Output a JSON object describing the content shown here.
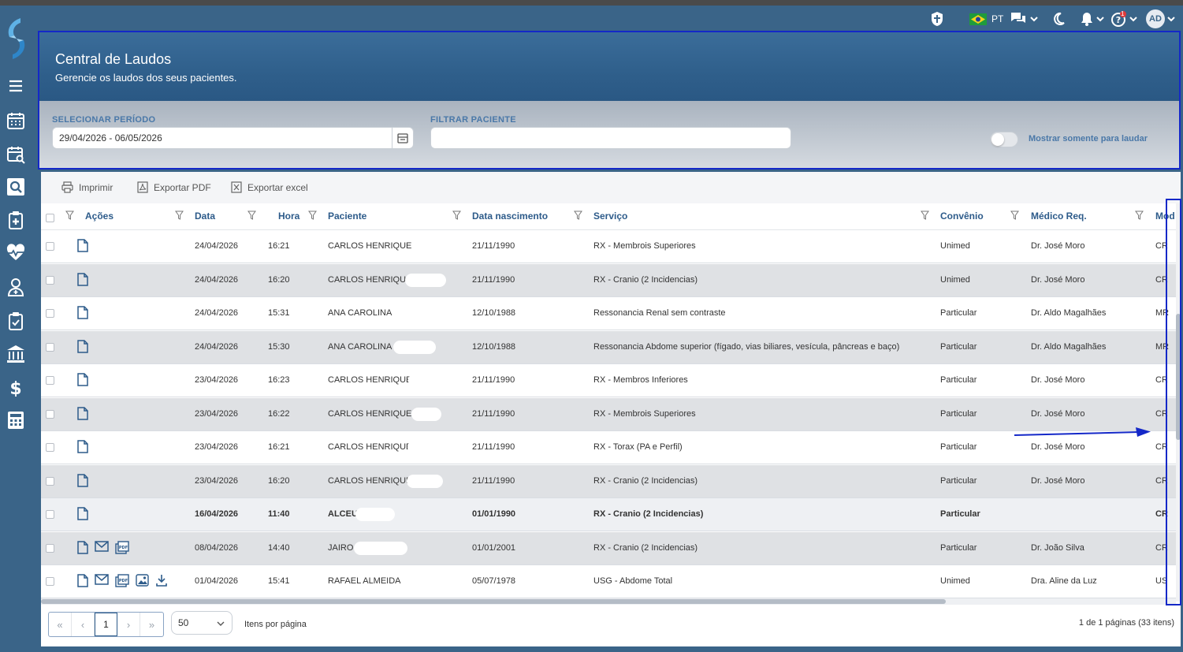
{
  "topbar": {
    "language": "PT",
    "avatar_initials": "AD",
    "help_badge": "1"
  },
  "header": {
    "title": "Central de Laudos",
    "subtitle": "Gerencie os laudos dos seus pacientes."
  },
  "filters": {
    "period_label": "SELECIONAR PERÍODO",
    "period_value": "29/04/2026 - 06/05/2026",
    "patient_label": "FILTRAR PACIENTE",
    "patient_value": "",
    "toggle_label": "Mostrar somente para laudar"
  },
  "toolbar": {
    "print": "Imprimir",
    "export_pdf": "Exportar PDF",
    "export_excel": "Exportar excel"
  },
  "table": {
    "columns": [
      "Ações",
      "Data",
      "Hora",
      "Paciente",
      "Data nascimento",
      "Serviço",
      "Convênio",
      "Médico Req.",
      "Mod"
    ],
    "rows": [
      {
        "data": "24/04/2026",
        "hora": "16:21",
        "paciente": "CARLOS HENRIQUE",
        "nasc": "21/11/1990",
        "servico": "RX - Membrois Superiores",
        "convenio": "Unimed",
        "medico": "Dr. José Moro",
        "mod": "CR"
      },
      {
        "data": "24/04/2026",
        "hora": "16:20",
        "paciente": "CARLOS HENRIQUE",
        "nasc": "21/11/1990",
        "servico": "RX - Cranio (2 Incidencias)",
        "convenio": "Unimed",
        "medico": "Dr. José Moro",
        "mod": "CR"
      },
      {
        "data": "24/04/2026",
        "hora": "15:31",
        "paciente": "ANA CAROLINA",
        "nasc": "12/10/1988",
        "servico": "Ressonancia Renal sem contraste",
        "convenio": "Particular",
        "medico": "Dr. Aldo Magalhães",
        "mod": "MR"
      },
      {
        "data": "24/04/2026",
        "hora": "15:30",
        "paciente": "ANA CAROLINA",
        "nasc": "12/10/1988",
        "servico": "Ressonancia Abdome superior (fígado, vias biliares, vesícula, pâncreas e baço)",
        "convenio": "Particular",
        "medico": "Dr. Aldo Magalhães",
        "mod": "MR"
      },
      {
        "data": "23/04/2026",
        "hora": "16:23",
        "paciente": "CARLOS HENRIQUE",
        "nasc": "21/11/1990",
        "servico": "RX - Membros Inferiores",
        "convenio": "Particular",
        "medico": "Dr. José Moro",
        "mod": "CR"
      },
      {
        "data": "23/04/2026",
        "hora": "16:22",
        "paciente": "CARLOS HENRIQUE",
        "nasc": "21/11/1990",
        "servico": "RX - Membrois Superiores",
        "convenio": "Particular",
        "medico": "Dr. José Moro",
        "mod": "CR"
      },
      {
        "data": "23/04/2026",
        "hora": "16:21",
        "paciente": "CARLOS HENRIQUE",
        "nasc": "21/11/1990",
        "servico": "RX - Torax (PA e Perfil)",
        "convenio": "Particular",
        "medico": "Dr. José Moro",
        "mod": "CR"
      },
      {
        "data": "23/04/2026",
        "hora": "16:20",
        "paciente": "CARLOS HENRIQUE",
        "nasc": "21/11/1990",
        "servico": "RX - Cranio (2 Incidencias)",
        "convenio": "Particular",
        "medico": "Dr. José Moro",
        "mod": "CR"
      },
      {
        "data": "16/04/2026",
        "hora": "11:40",
        "paciente": "ALCEU",
        "nasc": "01/01/1990",
        "servico": "RX - Cranio (2 Incidencias)",
        "convenio": "Particular",
        "medico": "",
        "mod": "CR"
      },
      {
        "data": "08/04/2026",
        "hora": "14:40",
        "paciente": "JAIRO",
        "nasc": "01/01/2001",
        "servico": "RX - Cranio (2 Incidencias)",
        "convenio": "Particular",
        "medico": "Dr. João Silva",
        "mod": "CR"
      },
      {
        "data": "01/04/2026",
        "hora": "15:41",
        "paciente": "RAFAEL ALMEIDA",
        "nasc": "05/07/1978",
        "servico": "USG - Abdome Total",
        "convenio": "Unimed",
        "medico": "Dra. Aline da Luz",
        "mod": "US"
      }
    ]
  },
  "footer": {
    "current_page": "1",
    "items_per_page": "50",
    "items_per_page_label": "Itens por página",
    "page_info": "1 de 1 páginas (33 itens)"
  },
  "colors": {
    "sidebar": "#3a6488",
    "accent": "#2d5b8a",
    "annotation": "#1428c8"
  }
}
